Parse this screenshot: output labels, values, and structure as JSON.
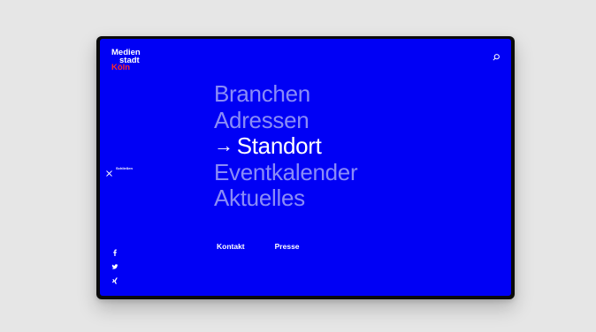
{
  "logo": {
    "line1": "Medien",
    "line2": "stadt",
    "line3": "Köln"
  },
  "header": {
    "search_icon": "search-icon"
  },
  "sidebar": {
    "close_label": "Schließen",
    "close_icon": "close-icon"
  },
  "menu": {
    "items": [
      {
        "label": "Branchen",
        "active": false
      },
      {
        "label": "Adressen",
        "active": false
      },
      {
        "label": "Standort",
        "active": true,
        "arrow": "→"
      },
      {
        "label": "Eventkalender",
        "active": false
      },
      {
        "label": "Aktuelles",
        "active": false
      }
    ]
  },
  "submenu": {
    "kontakt": "Kontakt",
    "presse": "Presse"
  },
  "social": {
    "icons": [
      "facebook-icon",
      "twitter-icon",
      "xing-icon"
    ]
  },
  "colors": {
    "background": "#0000f5",
    "inactive_menu": "#8a8cf7",
    "accent": "#ff2a2a",
    "page": "#e6e6e6"
  }
}
